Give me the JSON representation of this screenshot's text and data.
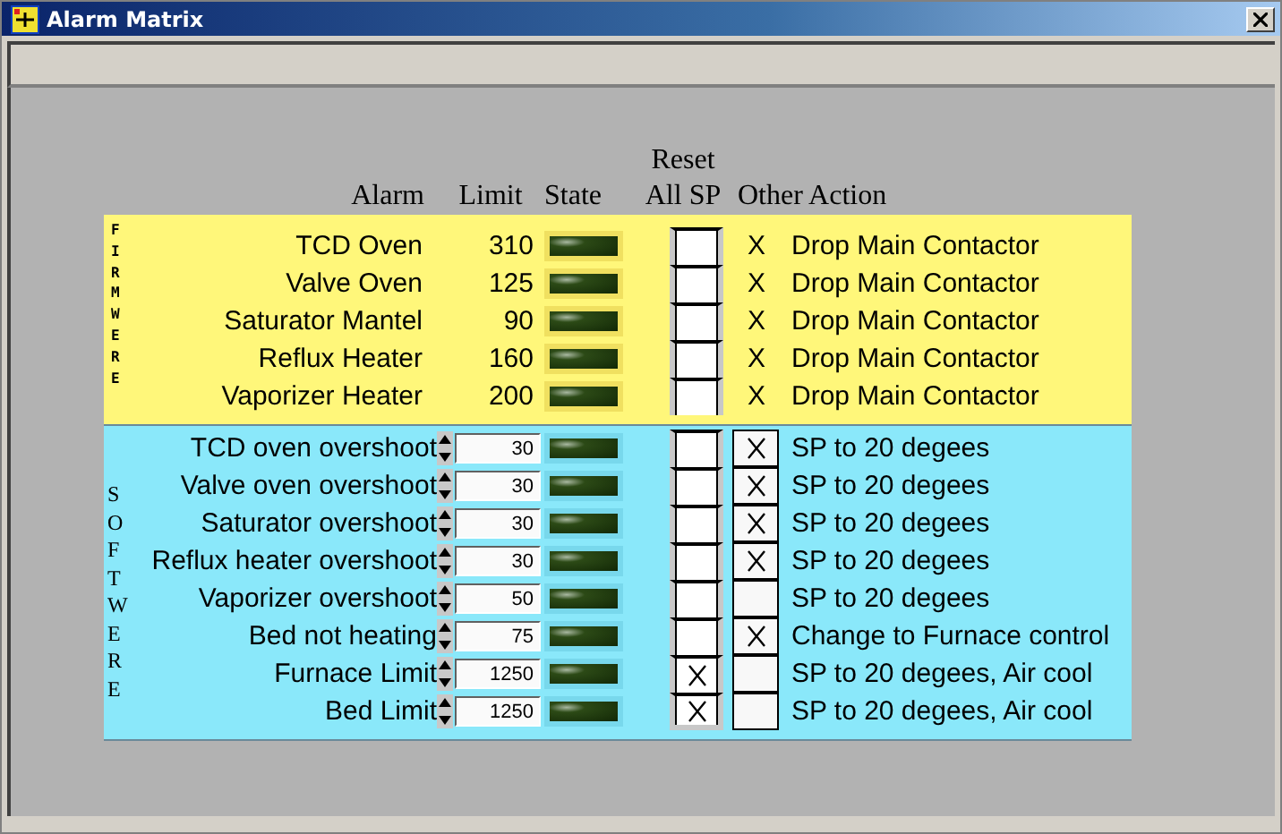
{
  "window": {
    "title": "Alarm Matrix"
  },
  "headers": {
    "alarm": "Alarm",
    "limit": "Limit",
    "state": "State",
    "reset": "Reset All SP",
    "action": "Other Action"
  },
  "sections": [
    {
      "kind": "firmware",
      "label": "FIRMWERE",
      "rows": [
        {
          "alarm": "TCD Oven",
          "limit": "310",
          "led_on": false,
          "reset_checked": false,
          "mark": "X",
          "action": "Drop Main Contactor"
        },
        {
          "alarm": "Valve Oven",
          "limit": "125",
          "led_on": false,
          "reset_checked": false,
          "mark": "X",
          "action": "Drop Main Contactor"
        },
        {
          "alarm": "Saturator Mantel",
          "limit": "90",
          "led_on": false,
          "reset_checked": false,
          "mark": "X",
          "action": "Drop Main Contactor"
        },
        {
          "alarm": "Reflux Heater",
          "limit": "160",
          "led_on": false,
          "reset_checked": false,
          "mark": "X",
          "action": "Drop Main Contactor"
        },
        {
          "alarm": "Vaporizer Heater",
          "limit": "200",
          "led_on": false,
          "reset_checked": false,
          "mark": "X",
          "action": "Drop Main Contactor"
        }
      ]
    },
    {
      "kind": "software",
      "label": "SOFTWERE",
      "rows": [
        {
          "alarm": "TCD oven overshoot",
          "limit": "30",
          "led_on": false,
          "reset_checked": false,
          "action_checked": true,
          "action": "SP to 20 degees"
        },
        {
          "alarm": "Valve oven overshoot",
          "limit": "30",
          "led_on": false,
          "reset_checked": false,
          "action_checked": true,
          "action": "SP to 20 degees"
        },
        {
          "alarm": "Saturator overshoot",
          "limit": "30",
          "led_on": false,
          "reset_checked": false,
          "action_checked": true,
          "action": "SP to 20 degees"
        },
        {
          "alarm": "Reflux heater overshoot",
          "limit": "30",
          "led_on": false,
          "reset_checked": false,
          "action_checked": true,
          "action": "SP to 20 degees"
        },
        {
          "alarm": "Vaporizer overshoot",
          "limit": "50",
          "led_on": false,
          "reset_checked": false,
          "action_checked": false,
          "action": "SP to 20 degees"
        },
        {
          "alarm": "Bed not heating",
          "limit": "75",
          "led_on": false,
          "reset_checked": false,
          "action_checked": true,
          "action": "Change to Furnace control"
        },
        {
          "alarm": "Furnace Limit",
          "limit": "1250",
          "led_on": false,
          "reset_checked": true,
          "action_checked": false,
          "action": "SP to 20 degees, Air cool"
        },
        {
          "alarm": "Bed Limit",
          "limit": "1250",
          "led_on": false,
          "reset_checked": true,
          "action_checked": false,
          "action": "SP to 20 degees, Air cool"
        }
      ]
    }
  ]
}
